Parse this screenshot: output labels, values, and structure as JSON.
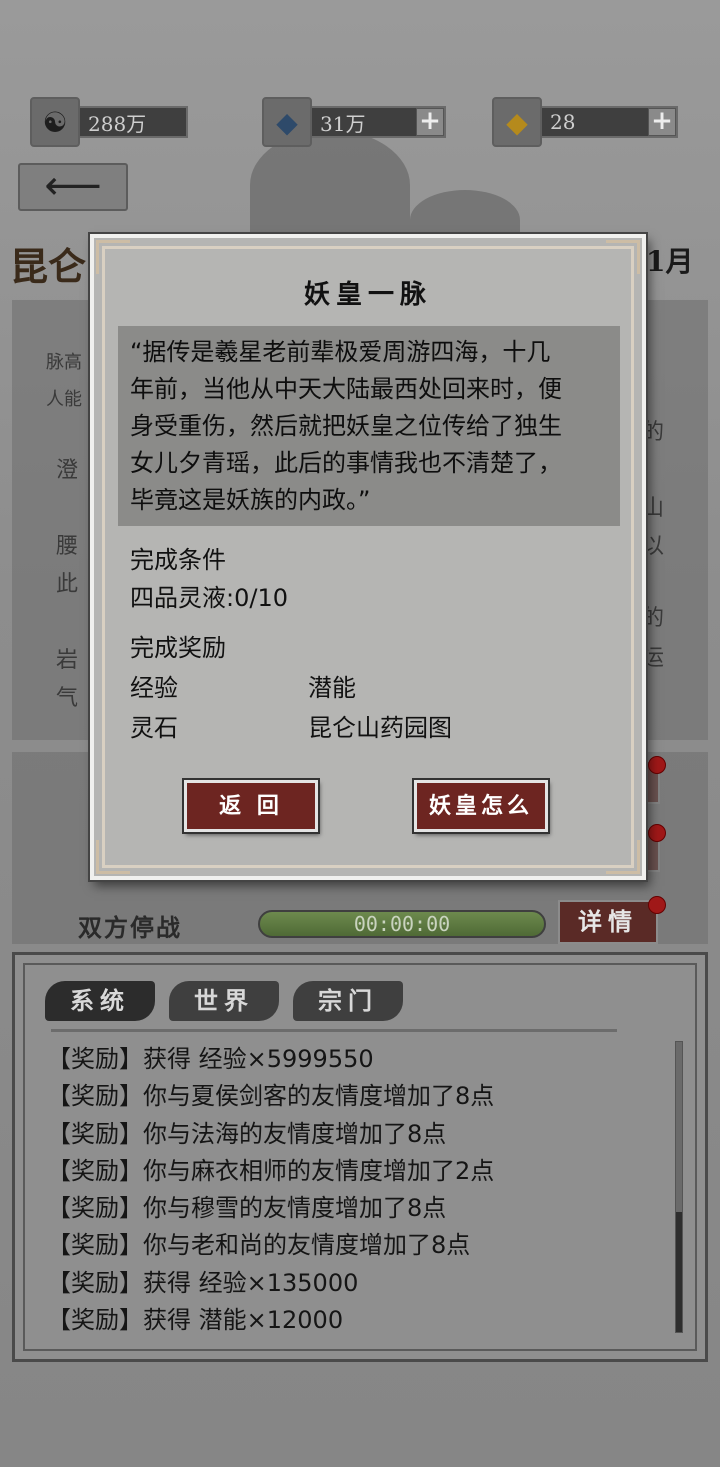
{
  "currencies": [
    {
      "icon": "yin-yang-icon",
      "value": "288万",
      "has_plus": false
    },
    {
      "icon": "crystal-icon",
      "value": "31万",
      "has_plus": true
    },
    {
      "icon": "gold-gem-icon",
      "value": "28",
      "has_plus": true
    }
  ],
  "background": {
    "title_fragment": "昆仑",
    "month_fragment": "1月",
    "left_lines": [
      "脉高",
      "人能",
      "澄",
      "腰",
      "此",
      "岩",
      "气"
    ],
    "right_lines": [
      "的",
      "山",
      "以",
      "的",
      "运"
    ]
  },
  "stop_war": {
    "label": "双方停战",
    "timer": "00:00:00",
    "detail_label": "详情"
  },
  "chat": {
    "tabs": [
      "系统",
      "世界",
      "宗门"
    ],
    "lines": [
      "【奖励】获得 经验×5999550",
      "【奖励】你与夏侯剑客的友情度增加了8点",
      "【奖励】你与法海的友情度增加了8点",
      "【奖励】你与麻衣相师的友情度增加了2点",
      "【奖励】你与穆雪的友情度增加了8点",
      "【奖励】你与老和尚的友情度增加了8点",
      "【奖励】获得 经验×135000",
      "【奖励】获得 潜能×12000"
    ]
  },
  "modal": {
    "title": "妖皇一脉",
    "quote_lines": [
      "“据传是羲星老前辈极爱周游四海，十几",
      "年前，当他从中天大陆最西处回来时，便",
      "身受重伤，然后就把妖皇之位传给了独生",
      "女儿夕青瑶，此后的事情我也不清楚了，",
      "毕竟这是妖族的内政。”"
    ],
    "condition_label": "完成条件",
    "condition_value": "四品灵液:0/10",
    "reward_label": "完成奖励",
    "rewards": [
      "经验",
      "潜能",
      "灵石",
      "昆仑山药园图"
    ],
    "back_button": "返 回",
    "action_button": "妖皇怎么"
  },
  "colors": {
    "button_red": "#6d2521",
    "timer_green": "#5b7a40",
    "badge_red": "#a01818"
  }
}
